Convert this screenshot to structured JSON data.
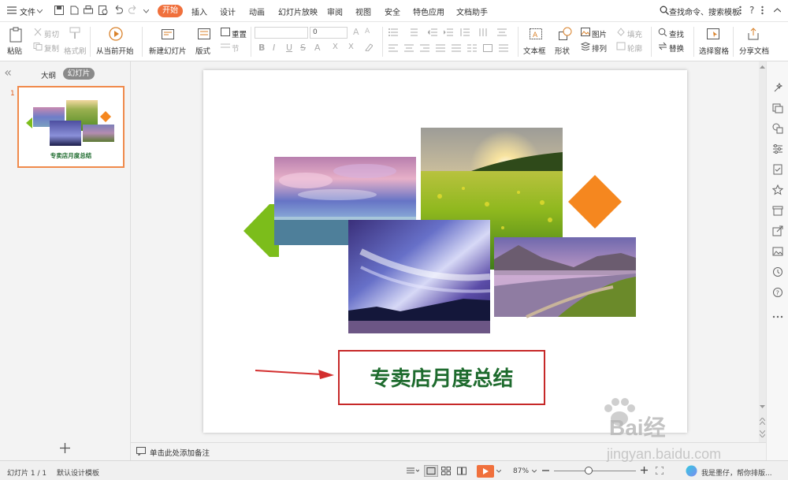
{
  "menubar": {
    "file": "文件",
    "tabs": [
      "开始",
      "插入",
      "设计",
      "动画",
      "幻灯片放映",
      "审阅",
      "视图",
      "安全",
      "特色应用",
      "文档助手"
    ],
    "search": "查找命令、搜索模板"
  },
  "ribbon": {
    "paste": "粘贴",
    "cut": "剪切",
    "copy": "复制",
    "format_painter": "格式刷",
    "from_current": "从当前开始",
    "new_slide": "新建幻灯片",
    "layout": "版式",
    "reset": "重置",
    "section": "节",
    "font_size": "0",
    "text_box": "文本框",
    "shape": "形状",
    "picture": "图片",
    "fill": "填充",
    "arrange": "排列",
    "outline": "轮廓",
    "find": "查找",
    "replace": "替换",
    "selection_pane": "选择窗格",
    "share": "分享文档"
  },
  "left_panel": {
    "tab_outline": "大纲",
    "tab_slides": "幻灯片",
    "slide_number": "1",
    "thumb_title": "专卖店月度总结"
  },
  "slide": {
    "title": "专卖店月度总结"
  },
  "notes": {
    "placeholder": "单击此处添加备注"
  },
  "status": {
    "slide_counter": "幻灯片 1 / 1",
    "template": "默认设计模板",
    "zoom": "87%",
    "user_hint": "我是墨仔，帮你排版..."
  },
  "watermark": {
    "brand": "Bai经验",
    "url": "jingyan.baidu.com"
  },
  "colors": {
    "accent": "#f0703c",
    "title_green": "#1e6b2e",
    "title_border": "#c62828",
    "arrow_red": "#d32f2f",
    "diamond_orange": "#f5871f",
    "arrow_green": "#7cbd1b"
  }
}
